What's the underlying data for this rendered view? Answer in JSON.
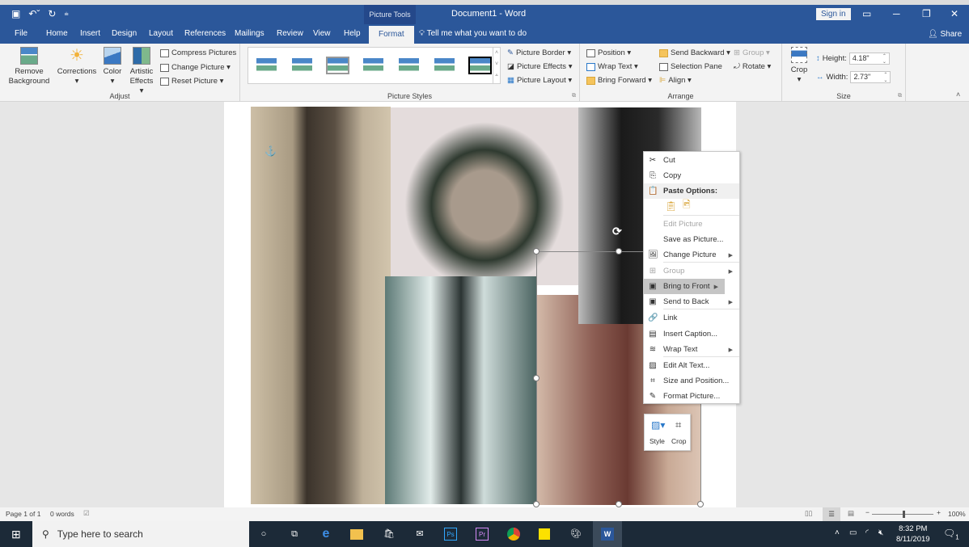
{
  "titlebar": {
    "qat": {
      "save": "💾",
      "undo": "↶",
      "undo_dd": "▾",
      "redo": "↻",
      "customize": "⇟"
    },
    "context_label": "Picture Tools",
    "doc_title": "Document1  -  Word",
    "sign_in": "Sign in",
    "ribbon_display": "▭",
    "minimize": "─",
    "restore": "❐",
    "close": "✕"
  },
  "tabs": [
    "File",
    "Home",
    "Insert",
    "Design",
    "Layout",
    "References",
    "Mailings",
    "Review",
    "View",
    "Help",
    "Format"
  ],
  "active_tab": "Format",
  "tell_me": "Tell me what you want to do",
  "share": "Share",
  "ribbon": {
    "adjust": {
      "label": "Adjust",
      "remove_background": [
        "Remove",
        "Background"
      ],
      "corrections": "Corrections",
      "color": "Color",
      "artistic_effects": [
        "Artistic",
        "Effects ▾"
      ],
      "compress": "Compress Pictures",
      "change_picture": "Change Picture ▾",
      "reset_picture": "Reset Picture  ▾"
    },
    "picture_styles": {
      "label": "Picture Styles",
      "border": "Picture Border ▾",
      "effects": "Picture Effects ▾",
      "layout": "Picture Layout ▾",
      "gallery_count": 7
    },
    "arrange": {
      "label": "Arrange",
      "position": "Position ▾",
      "wrap_text": "Wrap Text ▾",
      "bring_forward": "Bring Forward  ▾",
      "send_backward": "Send Backward  ▾",
      "selection_pane": "Selection Pane",
      "align": "Align ▾",
      "group": "Group ▾",
      "rotate": "Rotate ▾"
    },
    "size": {
      "label": "Size",
      "crop": "Crop",
      "height_label": "Height:",
      "height_value": "4.18\"",
      "width_label": "Width:",
      "width_value": "2.73\""
    }
  },
  "context_menu": [
    {
      "label": "Cut",
      "icon": "✂",
      "state": "normal"
    },
    {
      "label": "Copy",
      "icon": "⎘",
      "state": "normal"
    },
    {
      "label": "Paste Options:",
      "icon": "📋",
      "state": "header"
    },
    {
      "label": "",
      "icon": "",
      "state": "paste-icons"
    },
    {
      "label": "Edit Picture",
      "icon": "",
      "state": "disabled"
    },
    {
      "label": "Save as Picture...",
      "icon": "",
      "state": "normal"
    },
    {
      "label": "Change Picture",
      "icon": "🖼",
      "state": "normal",
      "submenu": true
    },
    {
      "label": "Group",
      "icon": "⊞",
      "state": "disabled",
      "submenu": true
    },
    {
      "label": "Bring to Front",
      "icon": "▣",
      "state": "highlighted",
      "submenu": true
    },
    {
      "label": "Send to Back",
      "icon": "▣",
      "state": "normal",
      "submenu": true
    },
    {
      "label": "Link",
      "icon": "🔗",
      "state": "normal"
    },
    {
      "label": "Insert Caption...",
      "icon": "▤",
      "state": "normal"
    },
    {
      "label": "Wrap Text",
      "icon": "≋",
      "state": "normal",
      "submenu": true
    },
    {
      "label": "Edit Alt Text...",
      "icon": "▨",
      "state": "normal"
    },
    {
      "label": "Size and Position...",
      "icon": "⌗",
      "state": "normal"
    },
    {
      "label": "Format Picture...",
      "icon": "✎",
      "state": "normal"
    }
  ],
  "mini_toolbar": {
    "style": "Style",
    "crop": "Crop"
  },
  "status": {
    "page": "Page 1 of 1",
    "words": "0 words",
    "zoom": "100%",
    "zoom_fraction": 0.5
  },
  "taskbar": {
    "search_placeholder": "Type here to search",
    "apps": [
      "Cortana",
      "Task View",
      "Edge",
      "File Explorer",
      "Store",
      "Mail",
      "Photoshop",
      "Premiere Pro",
      "Chrome",
      "Sticky Notes",
      "Paint",
      "Word"
    ],
    "time": "8:32 PM",
    "date": "8/11/2019",
    "notifications": "1"
  }
}
